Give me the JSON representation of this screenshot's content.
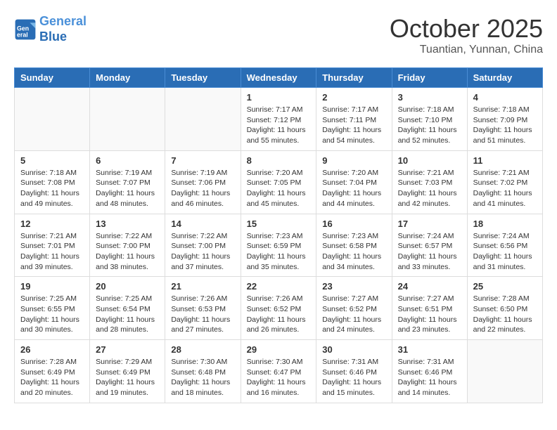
{
  "header": {
    "logo_line1": "General",
    "logo_line2": "Blue",
    "month": "October 2025",
    "location": "Tuantian, Yunnan, China"
  },
  "weekdays": [
    "Sunday",
    "Monday",
    "Tuesday",
    "Wednesday",
    "Thursday",
    "Friday",
    "Saturday"
  ],
  "weeks": [
    [
      {
        "day": "",
        "info": ""
      },
      {
        "day": "",
        "info": ""
      },
      {
        "day": "",
        "info": ""
      },
      {
        "day": "1",
        "info": "Sunrise: 7:17 AM\nSunset: 7:12 PM\nDaylight: 11 hours and 55 minutes."
      },
      {
        "day": "2",
        "info": "Sunrise: 7:17 AM\nSunset: 7:11 PM\nDaylight: 11 hours and 54 minutes."
      },
      {
        "day": "3",
        "info": "Sunrise: 7:18 AM\nSunset: 7:10 PM\nDaylight: 11 hours and 52 minutes."
      },
      {
        "day": "4",
        "info": "Sunrise: 7:18 AM\nSunset: 7:09 PM\nDaylight: 11 hours and 51 minutes."
      }
    ],
    [
      {
        "day": "5",
        "info": "Sunrise: 7:18 AM\nSunset: 7:08 PM\nDaylight: 11 hours and 49 minutes."
      },
      {
        "day": "6",
        "info": "Sunrise: 7:19 AM\nSunset: 7:07 PM\nDaylight: 11 hours and 48 minutes."
      },
      {
        "day": "7",
        "info": "Sunrise: 7:19 AM\nSunset: 7:06 PM\nDaylight: 11 hours and 46 minutes."
      },
      {
        "day": "8",
        "info": "Sunrise: 7:20 AM\nSunset: 7:05 PM\nDaylight: 11 hours and 45 minutes."
      },
      {
        "day": "9",
        "info": "Sunrise: 7:20 AM\nSunset: 7:04 PM\nDaylight: 11 hours and 44 minutes."
      },
      {
        "day": "10",
        "info": "Sunrise: 7:21 AM\nSunset: 7:03 PM\nDaylight: 11 hours and 42 minutes."
      },
      {
        "day": "11",
        "info": "Sunrise: 7:21 AM\nSunset: 7:02 PM\nDaylight: 11 hours and 41 minutes."
      }
    ],
    [
      {
        "day": "12",
        "info": "Sunrise: 7:21 AM\nSunset: 7:01 PM\nDaylight: 11 hours and 39 minutes."
      },
      {
        "day": "13",
        "info": "Sunrise: 7:22 AM\nSunset: 7:00 PM\nDaylight: 11 hours and 38 minutes."
      },
      {
        "day": "14",
        "info": "Sunrise: 7:22 AM\nSunset: 7:00 PM\nDaylight: 11 hours and 37 minutes."
      },
      {
        "day": "15",
        "info": "Sunrise: 7:23 AM\nSunset: 6:59 PM\nDaylight: 11 hours and 35 minutes."
      },
      {
        "day": "16",
        "info": "Sunrise: 7:23 AM\nSunset: 6:58 PM\nDaylight: 11 hours and 34 minutes."
      },
      {
        "day": "17",
        "info": "Sunrise: 7:24 AM\nSunset: 6:57 PM\nDaylight: 11 hours and 33 minutes."
      },
      {
        "day": "18",
        "info": "Sunrise: 7:24 AM\nSunset: 6:56 PM\nDaylight: 11 hours and 31 minutes."
      }
    ],
    [
      {
        "day": "19",
        "info": "Sunrise: 7:25 AM\nSunset: 6:55 PM\nDaylight: 11 hours and 30 minutes."
      },
      {
        "day": "20",
        "info": "Sunrise: 7:25 AM\nSunset: 6:54 PM\nDaylight: 11 hours and 28 minutes."
      },
      {
        "day": "21",
        "info": "Sunrise: 7:26 AM\nSunset: 6:53 PM\nDaylight: 11 hours and 27 minutes."
      },
      {
        "day": "22",
        "info": "Sunrise: 7:26 AM\nSunset: 6:52 PM\nDaylight: 11 hours and 26 minutes."
      },
      {
        "day": "23",
        "info": "Sunrise: 7:27 AM\nSunset: 6:52 PM\nDaylight: 11 hours and 24 minutes."
      },
      {
        "day": "24",
        "info": "Sunrise: 7:27 AM\nSunset: 6:51 PM\nDaylight: 11 hours and 23 minutes."
      },
      {
        "day": "25",
        "info": "Sunrise: 7:28 AM\nSunset: 6:50 PM\nDaylight: 11 hours and 22 minutes."
      }
    ],
    [
      {
        "day": "26",
        "info": "Sunrise: 7:28 AM\nSunset: 6:49 PM\nDaylight: 11 hours and 20 minutes."
      },
      {
        "day": "27",
        "info": "Sunrise: 7:29 AM\nSunset: 6:49 PM\nDaylight: 11 hours and 19 minutes."
      },
      {
        "day": "28",
        "info": "Sunrise: 7:30 AM\nSunset: 6:48 PM\nDaylight: 11 hours and 18 minutes."
      },
      {
        "day": "29",
        "info": "Sunrise: 7:30 AM\nSunset: 6:47 PM\nDaylight: 11 hours and 16 minutes."
      },
      {
        "day": "30",
        "info": "Sunrise: 7:31 AM\nSunset: 6:46 PM\nDaylight: 11 hours and 15 minutes."
      },
      {
        "day": "31",
        "info": "Sunrise: 7:31 AM\nSunset: 6:46 PM\nDaylight: 11 hours and 14 minutes."
      },
      {
        "day": "",
        "info": ""
      }
    ]
  ]
}
